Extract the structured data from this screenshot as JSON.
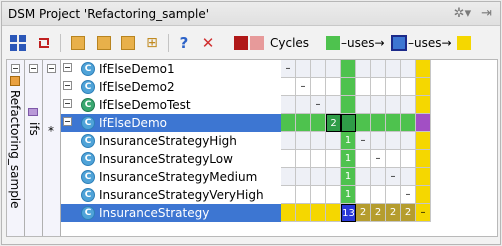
{
  "window": {
    "title": "DSM Project 'Refactoring_sample'"
  },
  "toolbar": {
    "legend": {
      "cycles": "Cycles",
      "uses1": "–uses→",
      "uses2": "–uses→"
    }
  },
  "tree": {
    "root": "Refactoring_sample",
    "pkg": "ifs",
    "star": "*",
    "rows": [
      {
        "label": "IfElseDemo1"
      },
      {
        "label": "IfElseDemo2"
      },
      {
        "label": "IfElseDemoTest"
      },
      {
        "label": "IfElseDemo"
      },
      {
        "label": "InsuranceStrategyHigh"
      },
      {
        "label": "InsuranceStrategyLow"
      },
      {
        "label": "InsuranceStrategyMedium"
      },
      {
        "label": "InsuranceStrategyVeryHigh"
      },
      {
        "label": "InsuranceStrategy"
      }
    ]
  },
  "matrix": {
    "cells": {
      "r1c1": "–",
      "r2c2": "–",
      "r3c3": "–",
      "r4c4": "2",
      "r5c5": "1",
      "r5c6": "–",
      "r6c5": "1",
      "r6c7": "–",
      "r7c5": "1",
      "r7c8": "–",
      "r8c5": "1",
      "r8c9": "–",
      "r9c5": "13",
      "r9c6": "2",
      "r9c7": "2",
      "r9c8": "2",
      "r9c9": "2",
      "r9c10": "–"
    }
  }
}
